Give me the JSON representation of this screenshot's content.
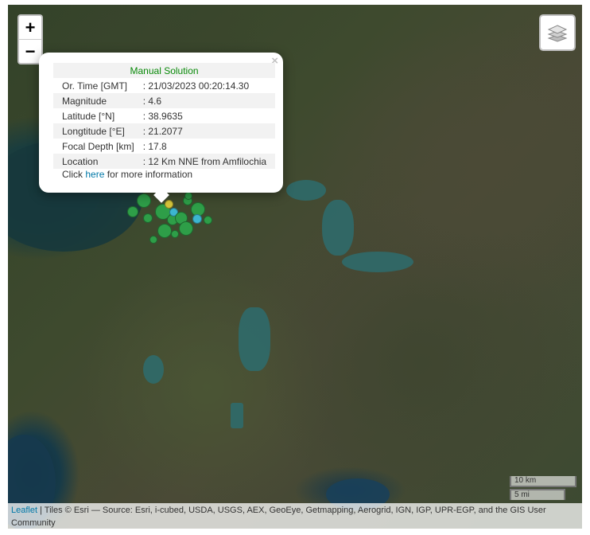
{
  "controls": {
    "zoom_in": "+",
    "zoom_out": "−"
  },
  "popup": {
    "heading": "Manual Solution",
    "close": "×",
    "rows": [
      {
        "label": "Or. Time [GMT]",
        "value": ": 21/03/2023 00:20:14.30"
      },
      {
        "label": "Magnitude",
        "value": ": 4.6"
      },
      {
        "label": "Latitude [°N]",
        "value": ": 38.9635"
      },
      {
        "label": "Longtitude [°E]",
        "value": ": 21.2077"
      },
      {
        "label": "Focal Depth [km]",
        "value": ": 17.8"
      },
      {
        "label": "Location",
        "value": ": 12 Km NNE from Amfilochia"
      }
    ],
    "click_prefix": "Click ",
    "click_link": "here",
    "click_suffix": " for more information"
  },
  "scale": {
    "metric": "10 km",
    "imperial": "5 mi"
  },
  "attribution": {
    "leaflet": "Leaflet",
    "text": " | Tiles © Esri — Source: Esri, i-cubed, USDA, USGS, AEX, GeoEye, Getmapping, Aerogrid, IGN, IGP, UPR-EGP, and the GIS User Community"
  },
  "colors": {
    "quake_green": "#2e9e48",
    "quake_yellow": "#d4c43a",
    "quake_cyan": "#3cb6d0",
    "popup_heading": "#0a8a0a",
    "link": "#0078a8"
  },
  "icons": {
    "layers": "layers-icon"
  }
}
